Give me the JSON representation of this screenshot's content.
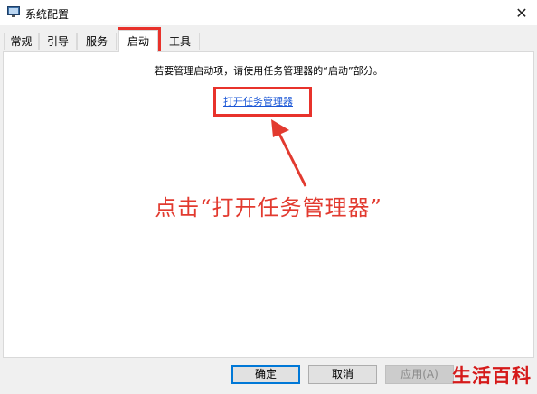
{
  "window": {
    "title": "系统配置",
    "close_glyph": "✕"
  },
  "tabs": [
    {
      "label": "常规"
    },
    {
      "label": "引导"
    },
    {
      "label": "服务"
    },
    {
      "label": "启动",
      "active": true
    },
    {
      "label": "工具"
    }
  ],
  "startup": {
    "hint": "若要管理启动项，请使用任务管理器的“启动”部分。",
    "link_label": "打开任务管理器"
  },
  "annotation": {
    "text": "点击“打开任务管理器”",
    "color": "#e23a2f"
  },
  "buttons": {
    "ok": "确定",
    "cancel": "取消",
    "apply": "应用(A)"
  },
  "watermark": "生活百科",
  "icons": {
    "app": "system-config-icon",
    "close": "close-icon"
  }
}
